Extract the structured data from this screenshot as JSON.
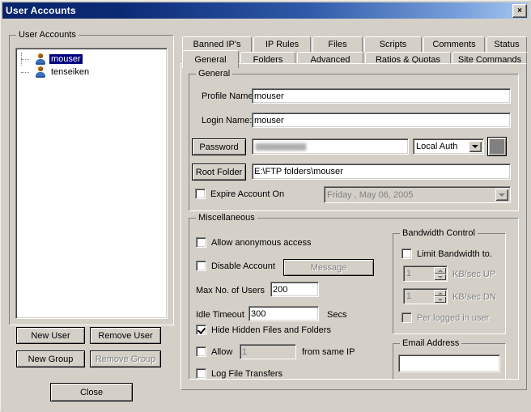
{
  "window": {
    "title": "User Accounts",
    "close_label": "×"
  },
  "left_panel": {
    "groupbox_title": "User Accounts",
    "tree_items": [
      {
        "label": "mouser",
        "selected": true,
        "icon": "user-icon"
      },
      {
        "label": "tenseiken",
        "selected": false,
        "icon": "user-icon"
      }
    ],
    "buttons": {
      "new_user": "New User",
      "remove_user": "Remove User",
      "new_group": "New Group",
      "remove_group": "Remove Group",
      "close": "Close"
    }
  },
  "tabs": {
    "row1": [
      {
        "label": "Banned IP's",
        "selected": false
      },
      {
        "label": "IP Rules",
        "selected": false
      },
      {
        "label": "Files",
        "selected": false
      },
      {
        "label": "Scripts",
        "selected": false
      },
      {
        "label": "Comments",
        "selected": false
      },
      {
        "label": "Status",
        "selected": false
      }
    ],
    "row2": [
      {
        "label": "General",
        "selected": true
      },
      {
        "label": "Folders",
        "selected": false
      },
      {
        "label": "Advanced",
        "selected": false
      },
      {
        "label": "Ratios & Quotas",
        "selected": false
      },
      {
        "label": "Site Commands",
        "selected": false
      }
    ]
  },
  "general": {
    "groupbox_title": "General",
    "profile_name_label": "Profile Name",
    "profile_name_value": "mouser",
    "login_name_label": "Login Name:",
    "login_name_value": "mouser",
    "password_button": "Password",
    "password_value": "",
    "auth_selected": "Local Auth",
    "root_folder_button": "Root Folder",
    "root_folder_value": "E:\\FTP folders\\mouser",
    "expire_account_label": "Expire Account On",
    "expire_account_checked": false,
    "expire_date_value": "Friday    ,    May     06, 2005"
  },
  "misc": {
    "groupbox_title": "Miscellaneous",
    "allow_anonymous_label": "Allow anonymous access",
    "allow_anonymous_checked": false,
    "disable_account_label": "Disable Account",
    "disable_account_checked": false,
    "message_button": "Message",
    "max_users_label": "Max No. of Users",
    "max_users_value": "200",
    "idle_timeout_label": "Idle Timeout",
    "idle_timeout_value": "300",
    "idle_timeout_units": "Secs",
    "hide_hidden_label": "Hide Hidden Files and Folders",
    "hide_hidden_checked": true,
    "allow_label": "Allow",
    "allow_checked": false,
    "allow_value": "1",
    "allow_suffix": "from same IP",
    "log_transfers_label": "Log File Transfers",
    "log_transfers_checked": false
  },
  "bandwidth": {
    "groupbox_title": "Bandwidth Control",
    "limit_label": "Limit Bandwidth to.",
    "limit_checked": false,
    "up_value": "1",
    "up_units": "KB/sec UP",
    "dn_value": "1",
    "dn_units": "KB/sec DN",
    "per_user_label": "Per logged in user",
    "per_user_checked": false
  },
  "email": {
    "groupbox_title": "Email Address",
    "value": ""
  },
  "colors": {
    "titlebar_start": "#0a246a",
    "titlebar_end": "#a6c8ee",
    "face": "#d4d0c8",
    "selection": "#000080",
    "swatch": "#808080"
  }
}
